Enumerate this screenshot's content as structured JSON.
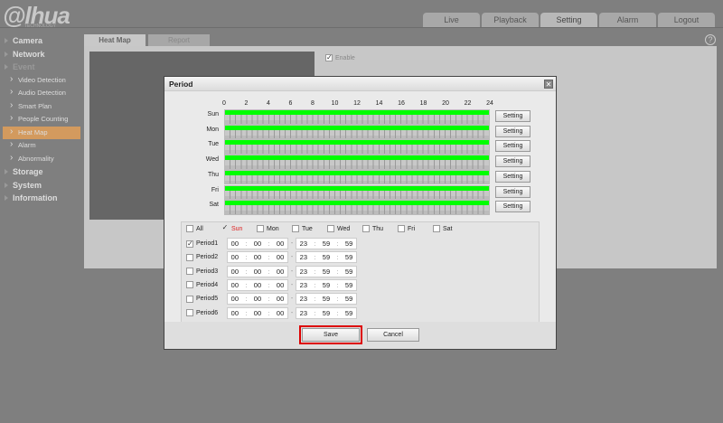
{
  "brand": {
    "logo": "alhua",
    "sub": "TECHNOLOGY"
  },
  "topnav": [
    "Live",
    "Playback",
    "Setting",
    "Alarm",
    "Logout"
  ],
  "sidebar": {
    "camera": "Camera",
    "network": "Network",
    "event": "Event",
    "event_items": [
      "Video Detection",
      "Audio Detection",
      "Smart Plan",
      "People Counting",
      "Heat Map",
      "Alarm",
      "Abnormality"
    ],
    "storage": "Storage",
    "system": "System",
    "information": "Information"
  },
  "tabs": [
    "Heat Map",
    "Report"
  ],
  "enable": {
    "label": "Enable",
    "checked": true
  },
  "modal": {
    "title": "Period",
    "hours": [
      "0",
      "2",
      "4",
      "6",
      "8",
      "10",
      "12",
      "14",
      "16",
      "18",
      "20",
      "22",
      "24"
    ],
    "days": [
      "Sun",
      "Mon",
      "Tue",
      "Wed",
      "Thu",
      "Fri",
      "Sat"
    ],
    "setting_label": "Setting",
    "schedule_note": "All days 00:00-24:00 active",
    "day_checks": [
      {
        "label": "All",
        "checked": false
      },
      {
        "label": "Sun",
        "checked": true
      },
      {
        "label": "Mon",
        "checked": false
      },
      {
        "label": "Tue",
        "checked": false
      },
      {
        "label": "Wed",
        "checked": false
      },
      {
        "label": "Thu",
        "checked": false
      },
      {
        "label": "Fri",
        "checked": false
      },
      {
        "label": "Sat",
        "checked": false
      }
    ],
    "periods": [
      {
        "label": "Period1",
        "checked": true,
        "start": [
          "00",
          "00",
          "00"
        ],
        "end": [
          "23",
          "59",
          "59"
        ]
      },
      {
        "label": "Period2",
        "checked": false,
        "start": [
          "00",
          "00",
          "00"
        ],
        "end": [
          "23",
          "59",
          "59"
        ]
      },
      {
        "label": "Period3",
        "checked": false,
        "start": [
          "00",
          "00",
          "00"
        ],
        "end": [
          "23",
          "59",
          "59"
        ]
      },
      {
        "label": "Period4",
        "checked": false,
        "start": [
          "00",
          "00",
          "00"
        ],
        "end": [
          "23",
          "59",
          "59"
        ]
      },
      {
        "label": "Period5",
        "checked": false,
        "start": [
          "00",
          "00",
          "00"
        ],
        "end": [
          "23",
          "59",
          "59"
        ]
      },
      {
        "label": "Period6",
        "checked": false,
        "start": [
          "00",
          "00",
          "00"
        ],
        "end": [
          "23",
          "59",
          "59"
        ]
      }
    ],
    "save": "Save",
    "cancel": "Cancel"
  }
}
